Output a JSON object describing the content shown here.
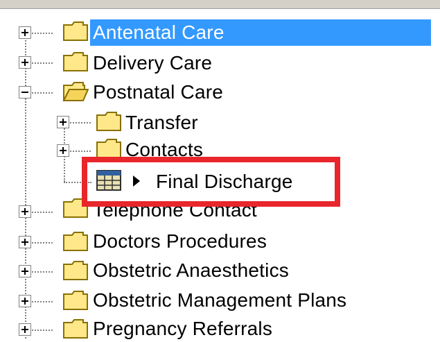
{
  "tree": {
    "items": [
      {
        "label": "Antenatal Care",
        "expander": "plus",
        "selected": true
      },
      {
        "label": "Delivery Care",
        "expander": "plus",
        "selected": false
      },
      {
        "label": "Postnatal Care",
        "expander": "minus",
        "selected": false,
        "open": true,
        "children": [
          {
            "label": "Transfer",
            "expander": "plus"
          },
          {
            "label": "Contacts",
            "expander": "plus"
          },
          {
            "label": "Final Discharge",
            "type": "form"
          }
        ]
      },
      {
        "label": "Telephone Contact",
        "expander": "plus",
        "selected": false
      },
      {
        "label": "Doctors Procedures",
        "expander": "plus",
        "selected": false
      },
      {
        "label": "Obstetric Anaesthetics",
        "expander": "plus",
        "selected": false
      },
      {
        "label": "Obstetric Management Plans",
        "expander": "plus",
        "selected": false
      },
      {
        "label": "Pregnancy Referrals",
        "expander": "plus",
        "selected": false
      }
    ]
  },
  "colors": {
    "selection": "#3399ff",
    "folder_fill": "#ffe88a",
    "folder_stroke": "#8a7000",
    "highlight": "#e8262b"
  },
  "icons": {
    "folder": "folder-icon",
    "open_folder": "folder-open-icon",
    "form": "table-grid-icon",
    "arrow": "play-arrow-icon",
    "expand": "plus-box-icon",
    "collapse": "minus-box-icon"
  }
}
